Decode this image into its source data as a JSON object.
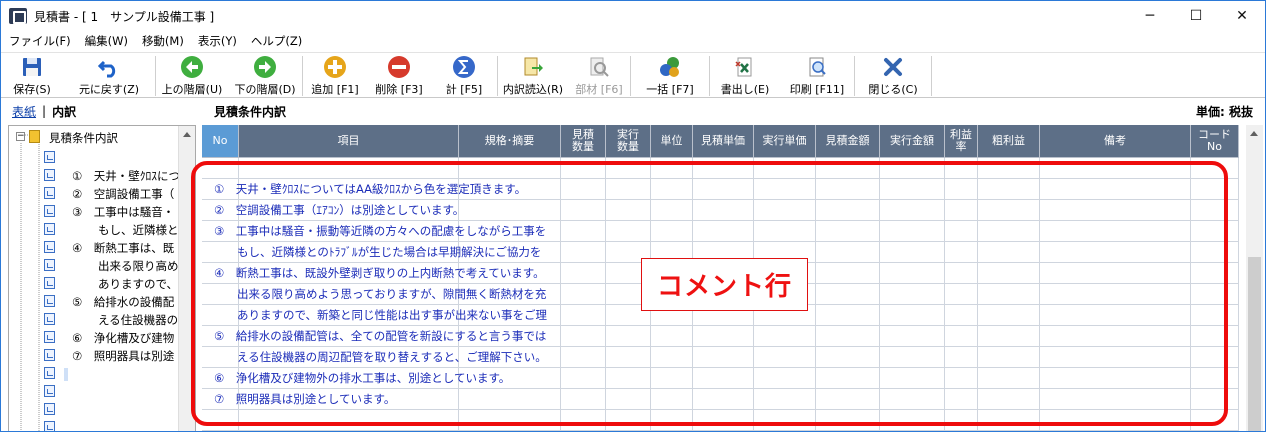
{
  "window": {
    "title": "見積書 - [ 1　サンプル設備工事 ]",
    "controls": [
      "─",
      "☐",
      "✕"
    ]
  },
  "menu": [
    "ファイル(F)",
    "編集(W)",
    "移動(M)",
    "表示(Y)",
    "ヘルプ(Z)"
  ],
  "toolbar": {
    "save": "保存(S)",
    "undo": "元に戻す(Z)",
    "up_level": "上の階層(U)",
    "down_level": "下の階層(D)",
    "add": "追加 [F1]",
    "delete": "削除 [F3]",
    "total": "計 [F5]",
    "import": "内訳読込(R)",
    "parts": "部材 [F6]",
    "bulk": "一括 [F7]",
    "export": "書出し(E)",
    "print": "印刷 [F11]",
    "close": "閉じる(C)"
  },
  "header": {
    "tab_cover": "表紙",
    "separator": "|",
    "tab_detail": "内訳",
    "section_title": "見積条件内訳",
    "unit_label": "単価: 税抜"
  },
  "tree": {
    "root": "見積条件内訳",
    "items": [
      {
        "label": "①　天井・壁ｸﾛｽにつ"
      },
      {
        "label": "②　空調設備工事（"
      },
      {
        "label": "③　工事中は騒音・"
      },
      {
        "label": "もし、近隣様と"
      },
      {
        "label": "④　断熱工事は、既"
      },
      {
        "label": "出来る限り高め"
      },
      {
        "label": "ありますので、"
      },
      {
        "label": "⑤　給排水の設備配"
      },
      {
        "label": "える住設機器の"
      },
      {
        "label": "⑥　浄化槽及び建物"
      },
      {
        "label": "⑦　照明器具は別途"
      }
    ]
  },
  "grid": {
    "columns": [
      "No",
      "項目",
      "規格･摘要",
      "見積\n数量",
      "実行\n数量",
      "単位",
      "見積単価",
      "実行単価",
      "見積金額",
      "実行金額",
      "利益\n率",
      "粗利益",
      "備考",
      "コード\nNo"
    ],
    "rows": [
      "①　天井・壁ｸﾛｽについてはAA級ｸﾛｽから色を選定頂きます。",
      "②　空調設備工事（ｴｱｺﾝ）は別途としています。",
      "③　工事中は騒音・振動等近隣の方々への配慮をしながら工事を",
      "　　もし、近隣様とのﾄﾗﾌﾞﾙが生じた場合は早期解決にご協力を",
      "④　断熱工事は、既設外壁剥ぎ取りの上内断熱で考えています。",
      "　　出来る限り高めよう思っておりますが、隙間無く断熱材を充",
      "　　ありますので、新築と同じ性能は出す事が出来ない事をご理",
      "⑤　給排水の設備配管は、全ての配管を新設にすると言う事では",
      "　　える住設機器の周辺配管を取り替えすると、ご理解下さい。",
      "⑥　浄化槽及び建物外の排水工事は、別途としています。",
      "⑦　照明器具は別途としています。"
    ]
  },
  "annotation": {
    "callout": "コメント行",
    "color": "#ee1111"
  }
}
